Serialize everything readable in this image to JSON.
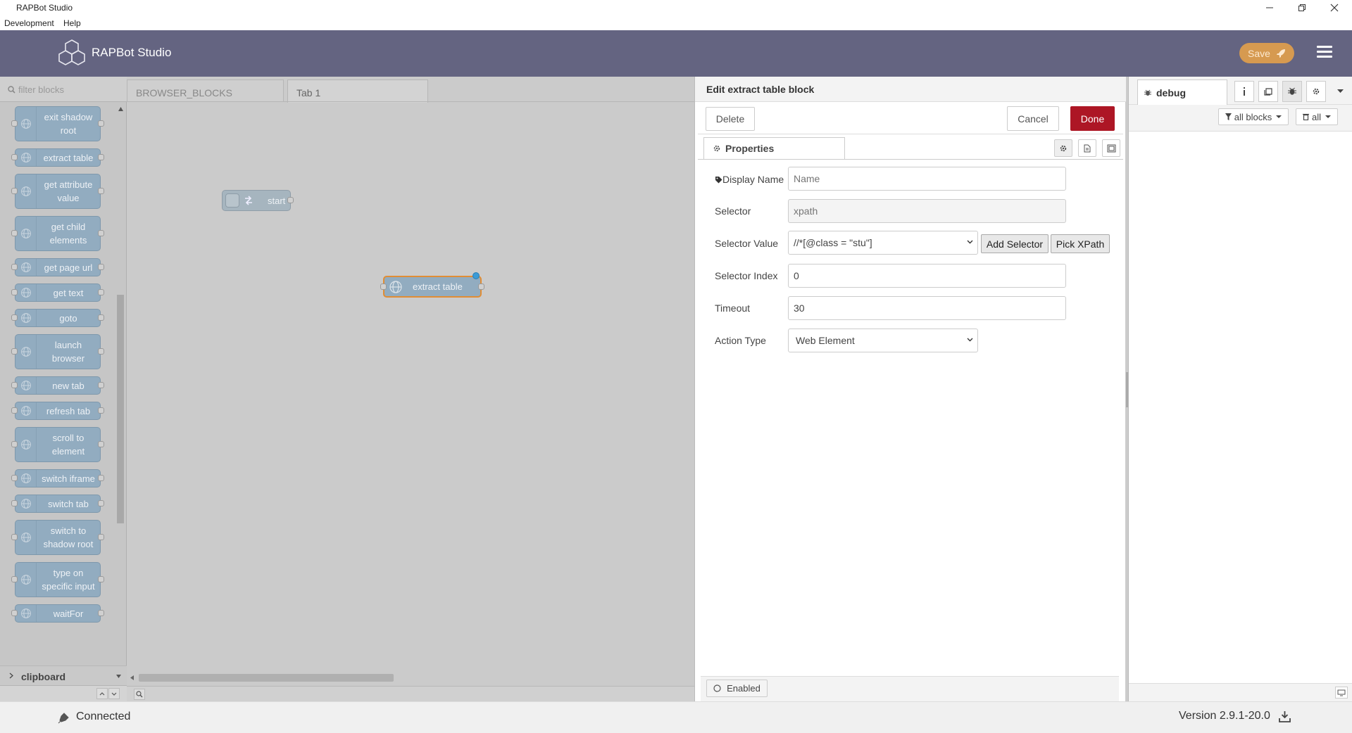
{
  "window": {
    "title": "RAPBot Studio"
  },
  "menu": {
    "items": [
      "Development",
      "Help"
    ]
  },
  "header": {
    "app_name": "RAPBot Studio",
    "save_label": "Save"
  },
  "palette": {
    "filter_placeholder": "filter blocks",
    "blocks": [
      "exit shadow root",
      "extract table",
      "get attribute value",
      "get child elements",
      "get page url",
      "get text",
      "goto",
      "launch browser",
      "new tab",
      "refresh tab",
      "scroll to element",
      "switch iframe",
      "switch tab",
      "switch to shadow root",
      "type on specific input",
      "waitFor"
    ],
    "category": "clipboard"
  },
  "workspace": {
    "tabs": [
      "BROWSER_BLOCKS",
      "Tab 1"
    ],
    "nodes": {
      "start": "start",
      "extract": "extract table"
    }
  },
  "editor": {
    "title": "Edit extract table block",
    "delete_label": "Delete",
    "cancel_label": "Cancel",
    "done_label": "Done",
    "properties_tab": "Properties",
    "fields": {
      "display_name": {
        "label": "Display Name",
        "placeholder": "Name",
        "value": ""
      },
      "selector": {
        "label": "Selector",
        "placeholder": "xpath",
        "value": ""
      },
      "selector_value": {
        "label": "Selector Value",
        "value": "//*[@class = \"stu\"]",
        "add_label": "Add Selector",
        "pick_label": "Pick XPath"
      },
      "selector_index": {
        "label": "Selector Index",
        "value": "0"
      },
      "timeout": {
        "label": "Timeout",
        "value": "30"
      },
      "action_type": {
        "label": "Action Type",
        "value": "Web Element"
      }
    },
    "enabled_label": "Enabled"
  },
  "debug": {
    "tab_label": "debug",
    "filter_label": "all blocks",
    "clear_label": "all"
  },
  "status": {
    "connection": "Connected",
    "version": "Version 2.9.1-20.0"
  },
  "colors": {
    "header_bg": "#646481",
    "save_button": "#d69a50",
    "done_button": "#ad1625",
    "block_color": "#92acc0"
  }
}
